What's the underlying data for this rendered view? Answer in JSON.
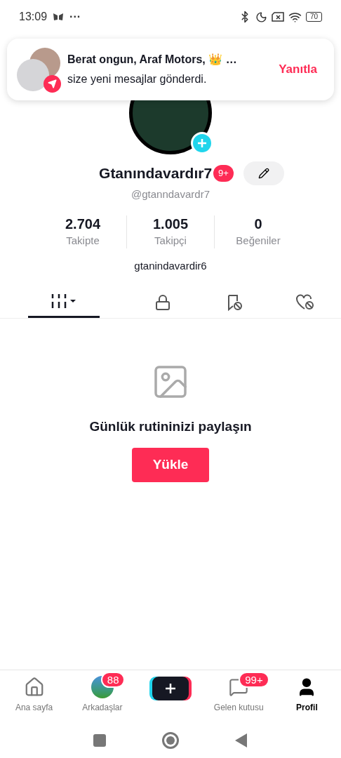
{
  "status_bar": {
    "time": "13:09",
    "more": "···",
    "battery": "70"
  },
  "notification": {
    "title": "Berat ongun, Araf Motors, 👑 …",
    "message": "size yeni mesajlar gönderdi.",
    "action": "Yanıtla"
  },
  "profile": {
    "name": "Gtanındavardır7",
    "badge": "9+",
    "handle": "@gtanndavardr7",
    "bio": "gtanindavardir6"
  },
  "stats": [
    {
      "value": "2.704",
      "label": "Takipte"
    },
    {
      "value": "1.005",
      "label": "Takipçi"
    },
    {
      "value": "0",
      "label": "Beğeniler"
    }
  ],
  "tabs": [
    {
      "kind": "grid",
      "selected": true
    },
    {
      "kind": "lock",
      "selected": false
    },
    {
      "kind": "bookmark",
      "selected": false
    },
    {
      "kind": "heart",
      "selected": false
    }
  ],
  "empty_state": {
    "title": "Günlük rutininizi paylaşın",
    "button": "Yükle"
  },
  "bottom_nav": [
    {
      "kind": "home",
      "label": "Ana sayfa",
      "selected": false
    },
    {
      "kind": "friends",
      "label": "Arkadaşlar",
      "badge": "88",
      "selected": false
    },
    {
      "kind": "create"
    },
    {
      "kind": "inbox",
      "label": "Gelen kutusu",
      "badge": "99+",
      "selected": false
    },
    {
      "kind": "profile",
      "label": "Profil",
      "selected": true
    }
  ]
}
